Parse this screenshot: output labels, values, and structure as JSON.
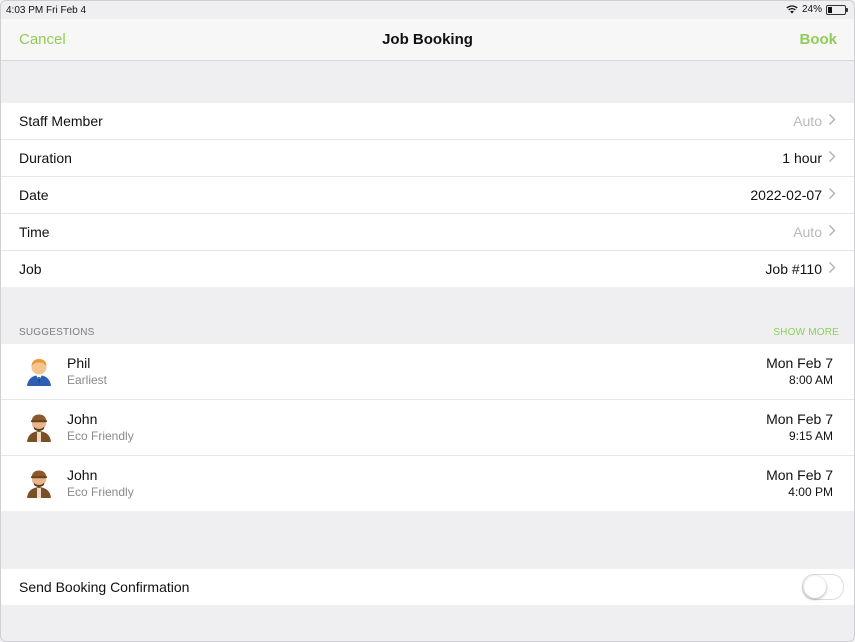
{
  "status_bar": {
    "time": "4:03 PM  Fri Feb 4",
    "battery": "24%"
  },
  "nav": {
    "cancel_label": "Cancel",
    "title": "Job Booking",
    "book_label": "Book"
  },
  "details": [
    {
      "label": "Staff Member",
      "value": "Auto",
      "placeholder": true
    },
    {
      "label": "Duration",
      "value": "1 hour",
      "placeholder": false
    },
    {
      "label": "Date",
      "value": "2022-02-07",
      "placeholder": false
    },
    {
      "label": "Time",
      "value": "Auto",
      "placeholder": true
    },
    {
      "label": "Job",
      "value": "Job #110",
      "placeholder": false
    }
  ],
  "suggestions": {
    "header": "SUGGESTIONS",
    "show_more": "SHOW MORE",
    "items": [
      {
        "name": "Phil",
        "tag": "Earliest",
        "date": "Mon Feb 7",
        "time": "8:00 AM",
        "avatar": "person-icon"
      },
      {
        "name": "John",
        "tag": "Eco Friendly",
        "date": "Mon Feb 7",
        "time": "9:15 AM",
        "avatar": "worker-icon"
      },
      {
        "name": "John",
        "tag": "Eco Friendly",
        "date": "Mon Feb 7",
        "time": "4:00 PM",
        "avatar": "worker-icon"
      }
    ]
  },
  "confirmation": {
    "label": "Send Booking Confirmation",
    "enabled": false
  },
  "colors": {
    "accent": "#8fce55",
    "placeholder": "#b9b9be"
  }
}
